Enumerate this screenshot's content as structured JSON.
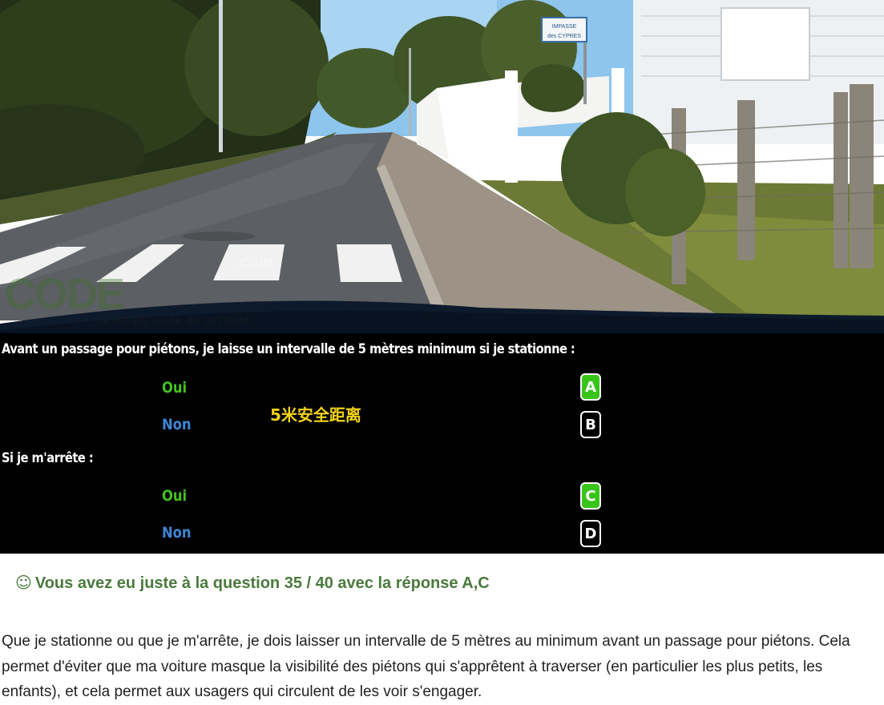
{
  "photo": {
    "street_sign": [
      "IMPASSE",
      "des CYPRES"
    ],
    "watermark": {
      "brand": "CODE",
      "domain": ".com",
      "tagline": "tests du code de la route"
    }
  },
  "question1": {
    "text": "Avant un passage pour piétons, je laisse un intervalle de 5 mètres minimum si je stationne :",
    "options": [
      {
        "label": "Oui",
        "letter": "A",
        "selected": true
      },
      {
        "label": "Non",
        "letter": "B",
        "selected": false
      }
    ]
  },
  "annotation": "5米安全距离",
  "question2": {
    "text": "Si je m'arrête :",
    "options": [
      {
        "label": "Oui",
        "letter": "C",
        "selected": true
      },
      {
        "label": "Non",
        "letter": "D",
        "selected": false
      }
    ]
  },
  "result": {
    "icon": "smiley-icon",
    "icon_glyph": "☺",
    "title": "Vous avez eu juste à la question 35 / 40 avec la réponse A,C",
    "explanation": "Que je stationne ou que je m'arrête, je dois laisser un intervalle de 5 mètres au minimum avant un passage pour piétons. Cela permet d'éviter que ma voiture masque la visibilité des piétons qui s'apprêtent à traverser (en particulier les plus petits, les enfants), et cela permet aux usagers qui circulent de les voir s'engager."
  },
  "colors": {
    "yes": "#43c41f",
    "no": "#3d86d6",
    "selected_badge": "#39c41a",
    "annotation": "#f2d21b",
    "result_title": "#4a7a3d"
  }
}
